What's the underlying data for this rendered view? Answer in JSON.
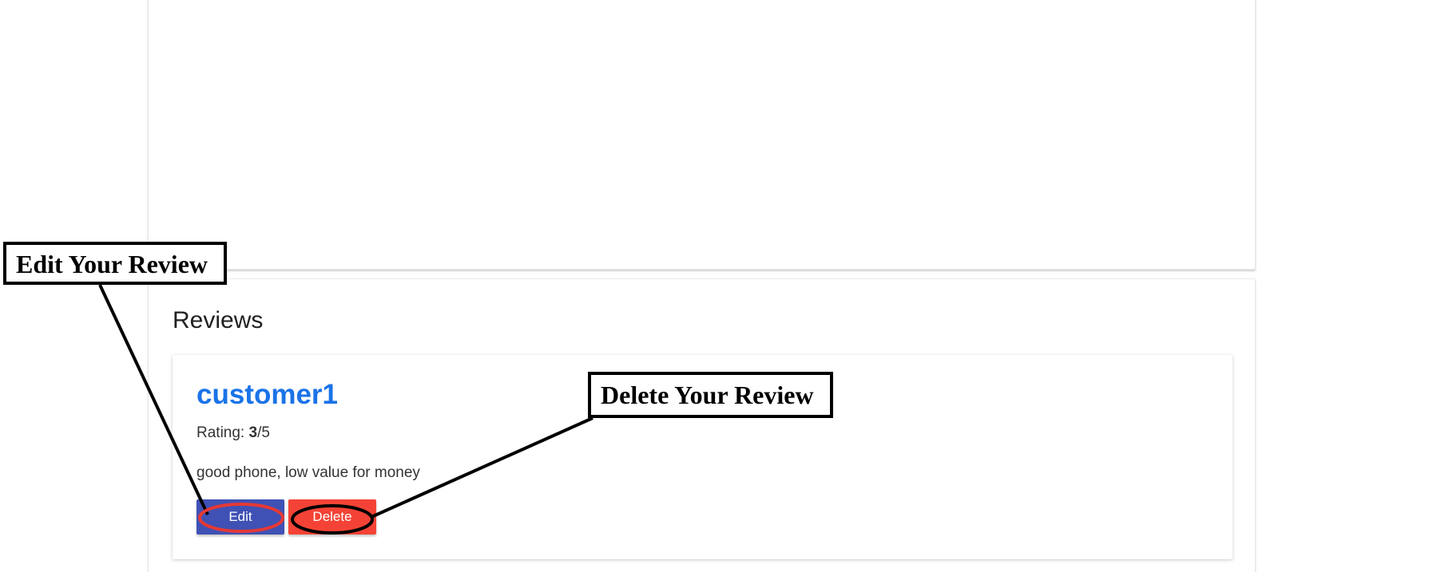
{
  "reviews_section": {
    "title": "Reviews",
    "review": {
      "author": "customer1",
      "rating_label": "Rating: ",
      "rating_value": "3",
      "rating_max": "/5",
      "text": "good phone, low value for money",
      "edit_label": "Edit",
      "delete_label": "Delete"
    }
  },
  "annotations": {
    "edit": "Edit Your Review",
    "delete": "Delete Your Review"
  },
  "colors": {
    "author_link": "#1a73e8",
    "edit_button": "#3f51b5",
    "delete_button": "#f44336",
    "edit_highlight": "#e53935",
    "delete_highlight": "#000000"
  }
}
